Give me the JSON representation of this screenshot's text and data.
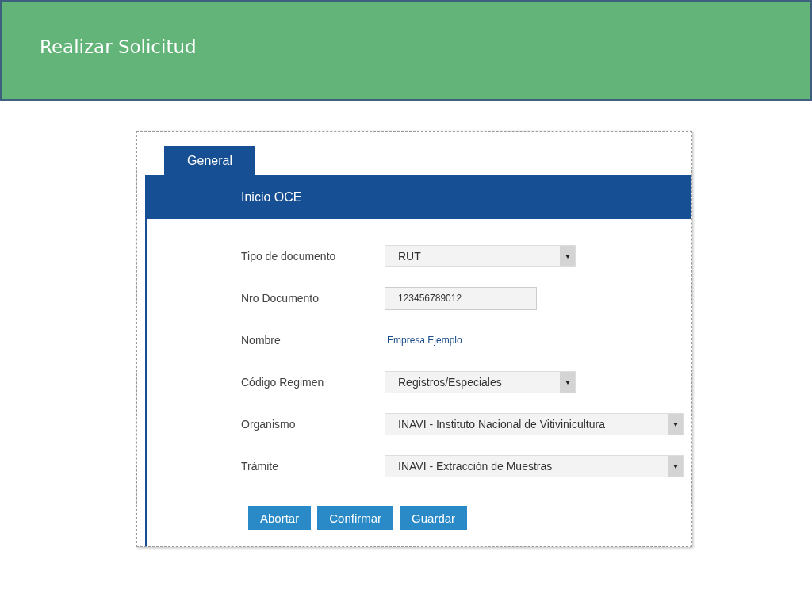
{
  "header": {
    "title": "Realizar Solicitud"
  },
  "tabs": [
    {
      "label": "General",
      "selected": true
    }
  ],
  "section": {
    "title": "Inicio OCE"
  },
  "fields": [
    {
      "label": "Tipo de documento",
      "kind": "dropdown",
      "value": "RUT"
    },
    {
      "label": "Nro Documento",
      "kind": "textbox",
      "value": "123456789012"
    },
    {
      "label": "Nombre",
      "kind": "text",
      "value": "Empresa Ejemplo"
    },
    {
      "label": "Código Regimen",
      "kind": "dropdown",
      "value": "Registros/Especiales"
    },
    {
      "label": "Organismo",
      "kind": "dropdown",
      "value": "INAVI - Instituto Nacional de Vitivinicultura"
    },
    {
      "label": "Trámite",
      "kind": "dropdown",
      "value": "INAVI - Extracción de Muestras"
    }
  ],
  "buttons": [
    "Abortar",
    "Confirmar",
    "Guardar"
  ]
}
